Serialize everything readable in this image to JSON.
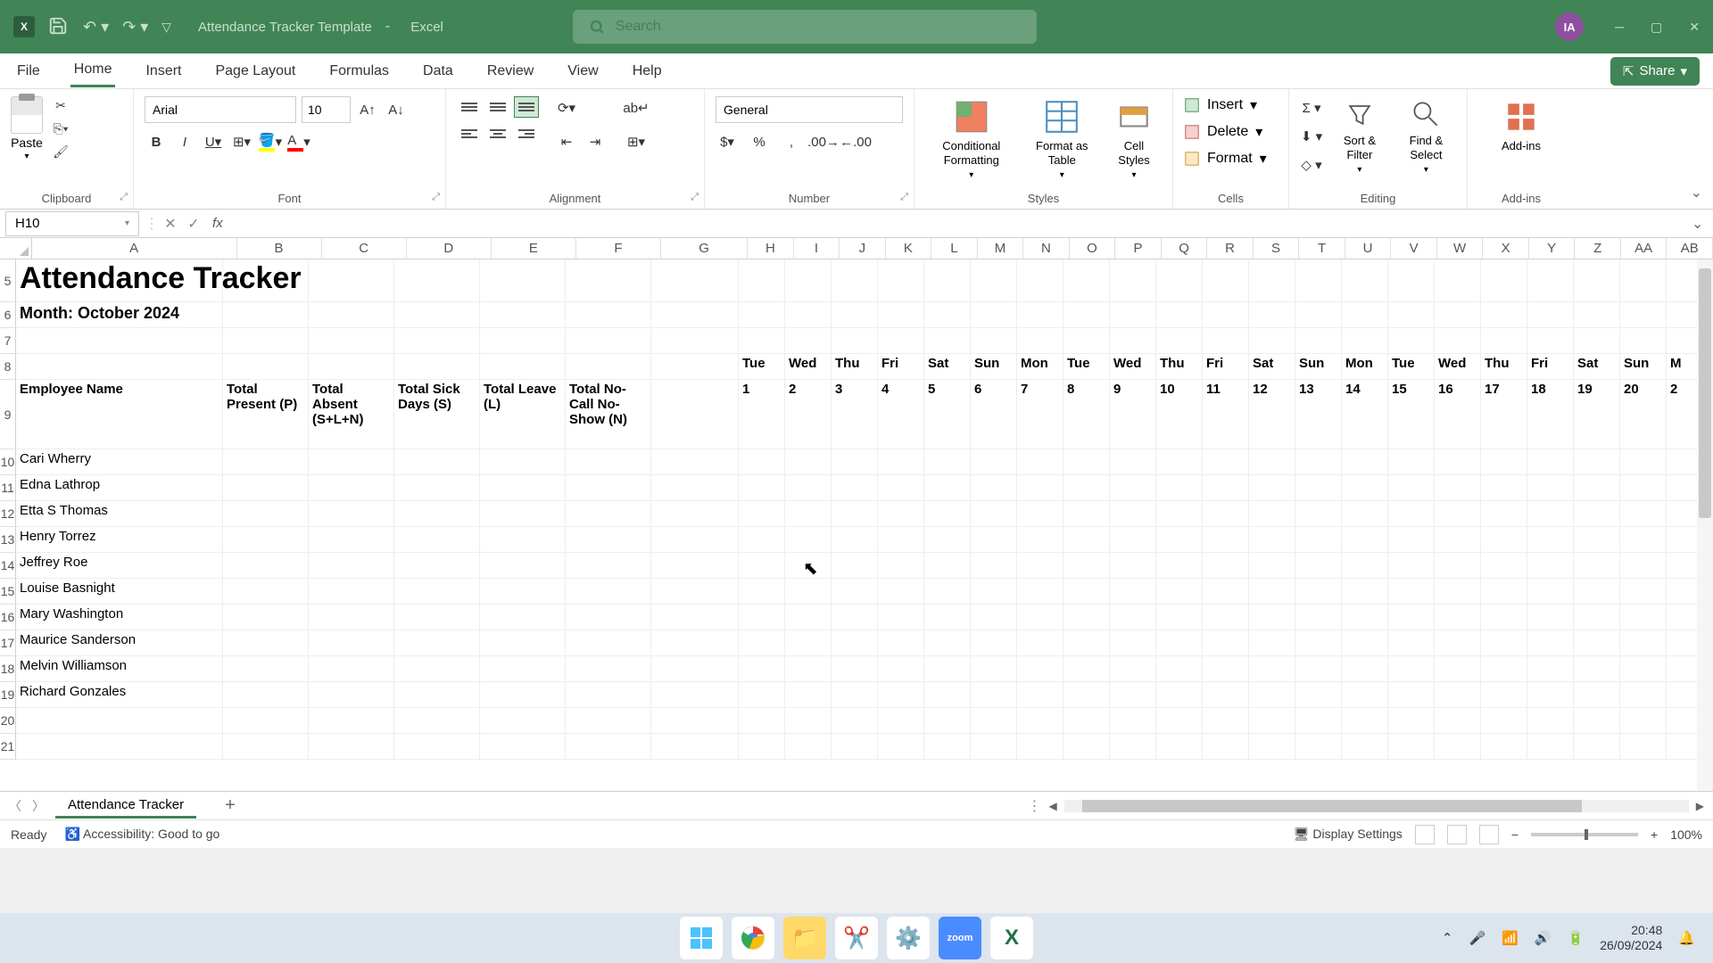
{
  "titlebar": {
    "doc_title": "Attendance Tracker Template",
    "app_name": "Excel",
    "search_placeholder": "Search",
    "user_initials": "IA"
  },
  "ribbon_tabs": [
    "File",
    "Home",
    "Insert",
    "Page Layout",
    "Formulas",
    "Data",
    "Review",
    "View",
    "Help"
  ],
  "active_tab": "Home",
  "share_label": "Share",
  "ribbon": {
    "clipboard": {
      "label": "Clipboard",
      "paste": "Paste"
    },
    "font": {
      "label": "Font",
      "name": "Arial",
      "size": "10"
    },
    "alignment": {
      "label": "Alignment"
    },
    "number": {
      "label": "Number",
      "format": "General"
    },
    "styles": {
      "label": "Styles",
      "conditional": "Conditional Formatting",
      "table": "Format as Table",
      "cell": "Cell Styles"
    },
    "cells": {
      "label": "Cells",
      "insert": "Insert",
      "delete": "Delete",
      "format": "Format"
    },
    "editing": {
      "label": "Editing",
      "sort": "Sort & Filter",
      "find": "Find & Select"
    },
    "addins": {
      "label": "Add-ins",
      "btn": "Add-ins"
    }
  },
  "name_box": "H10",
  "columns": [
    "A",
    "B",
    "C",
    "D",
    "E",
    "F",
    "G",
    "H",
    "I",
    "J",
    "K",
    "L",
    "M",
    "N",
    "O",
    "P",
    "Q",
    "R",
    "S",
    "T",
    "U",
    "V",
    "W",
    "X",
    "Y",
    "Z",
    "AA",
    "AB"
  ],
  "row_nums": [
    "5",
    "6",
    "7",
    "8",
    "9",
    "10",
    "11",
    "12",
    "13",
    "14",
    "15",
    "16",
    "17",
    "18",
    "19",
    "20",
    "21"
  ],
  "sheet": {
    "title": "Attendance Tracker",
    "month": "Month: October 2024",
    "headers": {
      "emp": "Employee Name",
      "b": "Total Present (P)",
      "c": "Total Absent (S+L+N)",
      "d": "Total Sick Days (S)",
      "e": "Total Leave (L)",
      "f": "Total No-Call No-Show (N)"
    },
    "days_top": [
      "Tue",
      "Wed",
      "Thu",
      "Fri",
      "Sat",
      "Sun",
      "Mon",
      "Tue",
      "Wed",
      "Thu",
      "Fri",
      "Sat",
      "Sun",
      "Mon",
      "Tue",
      "Wed",
      "Thu",
      "Fri",
      "Sat",
      "Sun",
      "M"
    ],
    "days_num": [
      "1",
      "2",
      "3",
      "4",
      "5",
      "6",
      "7",
      "8",
      "9",
      "10",
      "11",
      "12",
      "13",
      "14",
      "15",
      "16",
      "17",
      "18",
      "19",
      "20",
      "2"
    ],
    "employees": [
      "Cari Wherry",
      "Edna Lathrop",
      "Etta S Thomas",
      "Henry Torrez",
      "Jeffrey Roe",
      "Louise Basnight",
      "Mary Washington",
      "Maurice Sanderson",
      "Melvin Williamson",
      "Richard Gonzales"
    ]
  },
  "sheet_tab": "Attendance Tracker",
  "status": {
    "ready": "Ready",
    "accessibility": "Accessibility: Good to go",
    "display": "Display Settings",
    "zoom": "100%"
  },
  "taskbar": {
    "time": "20:48",
    "date": "26/09/2024"
  }
}
